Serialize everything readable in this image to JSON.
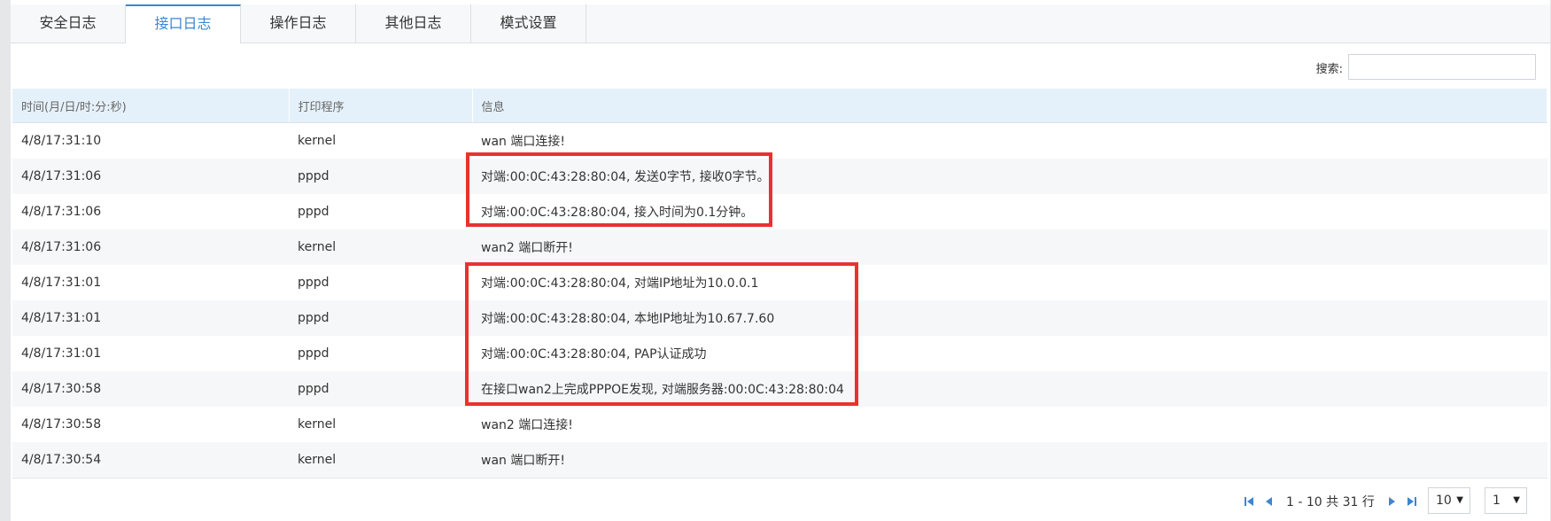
{
  "tabs": [
    {
      "label": "安全日志",
      "active": false
    },
    {
      "label": "接口日志",
      "active": true
    },
    {
      "label": "操作日志",
      "active": false
    },
    {
      "label": "其他日志",
      "active": false
    },
    {
      "label": "模式设置",
      "active": false
    }
  ],
  "search": {
    "label": "搜索:",
    "value": "",
    "placeholder": ""
  },
  "table": {
    "headers": [
      "时间(月/日/时:分:秒)",
      "打印程序",
      "信息"
    ],
    "rows": [
      [
        "4/8/17:31:10",
        "kernel",
        "wan 端口连接!"
      ],
      [
        "4/8/17:31:06",
        "pppd",
        "对端:00:0C:43:28:80:04, 发送0字节, 接收0字节。"
      ],
      [
        "4/8/17:31:06",
        "pppd",
        "对端:00:0C:43:28:80:04, 接入时间为0.1分钟。"
      ],
      [
        "4/8/17:31:06",
        "kernel",
        "wan2 端口断开!"
      ],
      [
        "4/8/17:31:01",
        "pppd",
        "对端:00:0C:43:28:80:04, 对端IP地址为10.0.0.1"
      ],
      [
        "4/8/17:31:01",
        "pppd",
        "对端:00:0C:43:28:80:04, 本地IP地址为10.67.7.60"
      ],
      [
        "4/8/17:31:01",
        "pppd",
        "对端:00:0C:43:28:80:04, PAP认证成功"
      ],
      [
        "4/8/17:30:58",
        "pppd",
        "在接口wan2上完成PPPOE发现, 对端服务器:00:0C:43:28:80:04"
      ],
      [
        "4/8/17:30:58",
        "kernel",
        "wan2 端口连接!"
      ],
      [
        "4/8/17:30:54",
        "kernel",
        "wan 端口断开!"
      ]
    ]
  },
  "pagination": {
    "summary": "1 - 10 共 31 行",
    "page_size": "10",
    "page": "1",
    "icons": [
      "first-page-icon",
      "prev-page-icon",
      "next-page-icon",
      "last-page-icon"
    ]
  },
  "colors": {
    "accent": "#3d86d1",
    "highlight": "#e8322f",
    "header_bg": "#e5f1fa",
    "pager_icon": "#3d86d1"
  }
}
